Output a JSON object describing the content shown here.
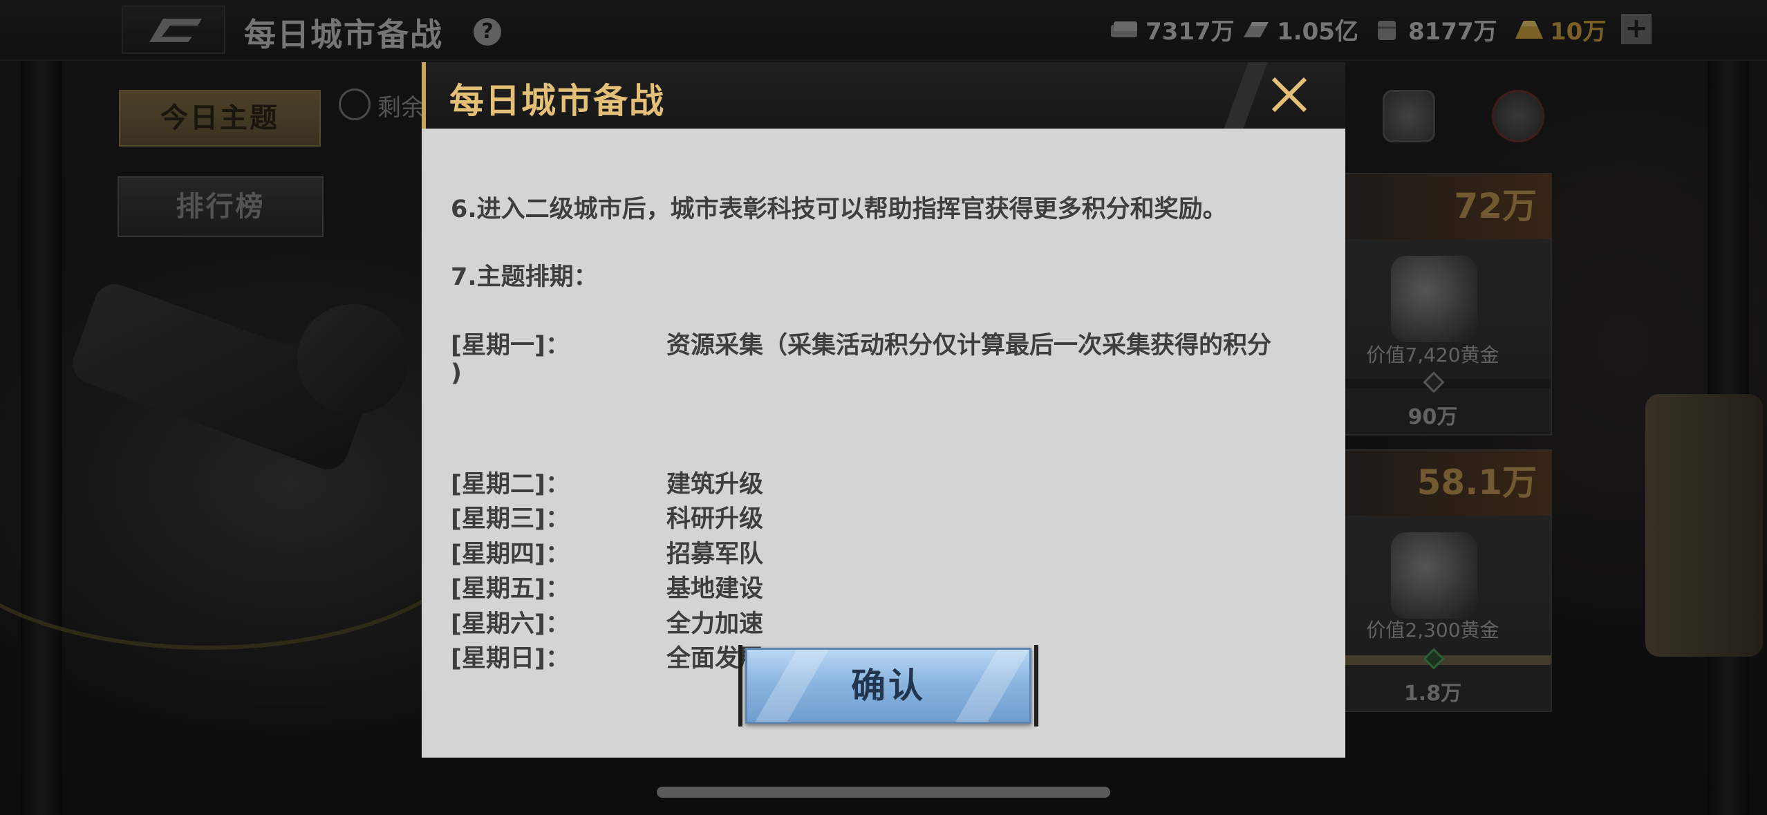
{
  "header": {
    "title": "每日城市备战",
    "help_icon": "question-circle-icon"
  },
  "resources": [
    {
      "icon": "cash-stack-icon",
      "value": "7317万"
    },
    {
      "icon": "iron-ingot-icon",
      "value": "1.05亿"
    },
    {
      "icon": "oil-barrel-icon",
      "value": "8177万"
    },
    {
      "icon": "gold-bar-icon",
      "value": "10万"
    }
  ],
  "sidebar": {
    "today_theme": "今日主题",
    "leaderboard": "排行榜",
    "remaining_label": "剩余"
  },
  "rewards": [
    {
      "points": "72万",
      "value_label": "价值7,420黄金",
      "milestone": "90万",
      "progress": 0
    },
    {
      "points": "58.1万",
      "value_label": "价值2,300黄金",
      "milestone": "1.8万",
      "progress": 1
    }
  ],
  "modal": {
    "title": "每日城市备战",
    "rule6": "6.进入二级城市后，城市表彰科技可以帮助指挥官获得更多积分和奖励。",
    "rule7": "7.主题排期：",
    "schedule": [
      {
        "day": "[星期一]：",
        "task": "资源采集（采集活动积分仅计算最后一次采集获得的积分",
        "task_cont": ")"
      },
      {
        "day": "[星期二]：",
        "task": "建筑升级"
      },
      {
        "day": "[星期三]：",
        "task": "科研升级"
      },
      {
        "day": "[星期四]：",
        "task": "招募军队"
      },
      {
        "day": "[星期五]：",
        "task": "基地建设"
      },
      {
        "day": "[星期六]：",
        "task": "全力加速"
      },
      {
        "day": "[星期日]：",
        "task": "全面发展"
      }
    ],
    "confirm_label": "确认",
    "close_icon": "close-x-icon"
  },
  "colors": {
    "accent_gold": "#e4bf77",
    "modal_body_bg": "#d4d4d4",
    "confirm_blue": "#8cb6e0"
  }
}
